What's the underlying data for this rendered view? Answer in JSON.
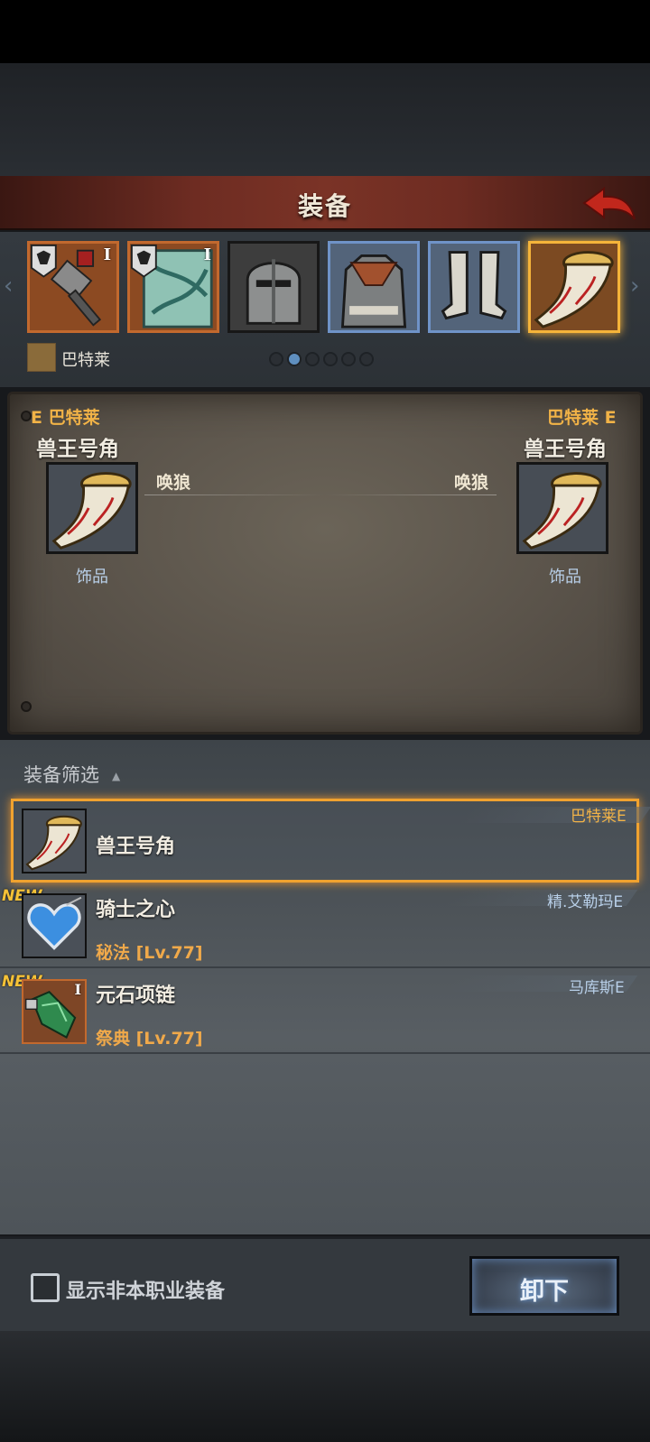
{
  "header": {
    "title": "装备"
  },
  "character": {
    "name": "巴特莱"
  },
  "slots": [
    {
      "name": "weapon-slot",
      "tier": "I"
    },
    {
      "name": "shield-slot",
      "tier": "I"
    },
    {
      "name": "helmet-slot",
      "tier": ""
    },
    {
      "name": "armor-slot",
      "tier": ""
    },
    {
      "name": "boots-slot",
      "tier": ""
    },
    {
      "name": "accessory-slot",
      "tier": ""
    }
  ],
  "pager": {
    "pages": 6,
    "active": 1
  },
  "compare": {
    "left": {
      "owner": "E 巴特莱",
      "name": "兽王号角",
      "skill": "唤狼",
      "type": "饰品"
    },
    "right": {
      "owner": "巴特莱 E",
      "name": "兽王号角",
      "skill": "唤狼",
      "type": "饰品"
    }
  },
  "filter": {
    "label": "装备筛选"
  },
  "items": [
    {
      "name": "兽王号角",
      "sub": "",
      "owner": "巴特莱E",
      "new": false,
      "badge": ""
    },
    {
      "name": "骑士之心",
      "sub": "秘法 [Lv.77]",
      "owner": "精.艾勒玛E",
      "new": true,
      "badge": "NEW"
    },
    {
      "name": "元石项链",
      "sub": "祭典 [Lv.77]",
      "owner": "马库斯E",
      "new": true,
      "badge": "NEW",
      "tier": "I"
    }
  ],
  "bottom": {
    "checkbox_label": "显示非本职业装备",
    "unequip_label": "卸下"
  },
  "colors": {
    "accent_gold": "#f2b347",
    "selected_border": "#f0a22f",
    "owner_blue": "#b8cfe8"
  }
}
